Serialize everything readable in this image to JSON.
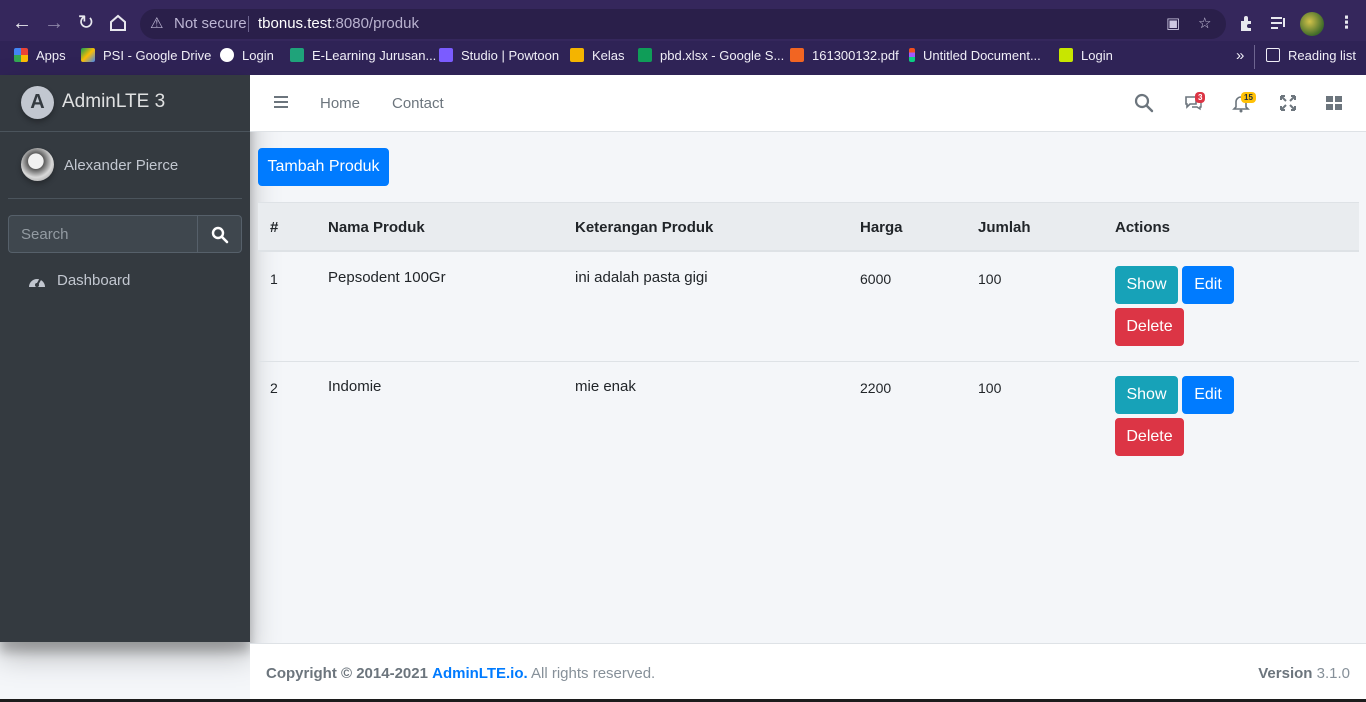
{
  "browser": {
    "security_label": "Not secure",
    "url_host": "tbonus.test",
    "url_path": ":8080/produk",
    "bookmarks": [
      {
        "label": "Apps",
        "icon": "apps-grid-icon",
        "color": "#ea4335"
      },
      {
        "label": "PSI - Google Drive",
        "icon": "google-drive-icon",
        "color": "#fbbc04"
      },
      {
        "label": "Login",
        "icon": "globe-icon",
        "color": "#ffffff"
      },
      {
        "label": "E-Learning Jurusan...",
        "icon": "elearning-icon",
        "color": "#1fa37a"
      },
      {
        "label": "Studio | Powtoon",
        "icon": "powtoon-icon",
        "color": "#7b5cff"
      },
      {
        "label": "Kelas",
        "icon": "classroom-icon",
        "color": "#f4b400"
      },
      {
        "label": "pbd.xlsx - Google S...",
        "icon": "sheets-icon",
        "color": "#0f9d58"
      },
      {
        "label": "161300132.pdf",
        "icon": "pdf-icon",
        "color": "#f26522"
      },
      {
        "label": "Untitled Document...",
        "icon": "figma-icon",
        "color": "#a259ff"
      },
      {
        "label": "Login",
        "icon": "vuetify-icon",
        "color": "#c8e600"
      }
    ],
    "more_label": "»",
    "reading_list_label": "Reading list"
  },
  "sidebar": {
    "brand": "AdminLTE 3",
    "user_name": "Alexander Pierce",
    "search_placeholder": "Search",
    "nav": [
      {
        "label": "Dashboard",
        "icon": "tachometer-icon"
      }
    ]
  },
  "header": {
    "nav": [
      "Home",
      "Contact"
    ],
    "messages_count": "3",
    "notifications_count": "15"
  },
  "content": {
    "add_button": "Tambah Produk",
    "columns": [
      "#",
      "Nama Produk",
      "Keterangan Produk",
      "Harga",
      "Jumlah",
      "Actions"
    ],
    "rows": [
      {
        "no": "1",
        "nama": "Pepsodent 100Gr",
        "keterangan": "ini adalah pasta gigi",
        "harga": "6000",
        "jumlah": "100"
      },
      {
        "no": "2",
        "nama": "Indomie",
        "keterangan": "mie enak",
        "harga": "2200",
        "jumlah": "100"
      }
    ],
    "actions": {
      "show": "Show",
      "edit": "Edit",
      "delete": "Delete"
    }
  },
  "footer": {
    "copyright_prefix": "Copyright © 2014-2021",
    "copyright_link": "AdminLTE.io.",
    "copyright_suffix": "All rights reserved.",
    "version_label": "Version",
    "version_value": "3.1.0"
  },
  "colors": {
    "primary": "#007bff",
    "info": "#17a2b8",
    "danger": "#dc3545",
    "sidebar_bg": "#343a40",
    "browser_frame": "#35275c"
  }
}
